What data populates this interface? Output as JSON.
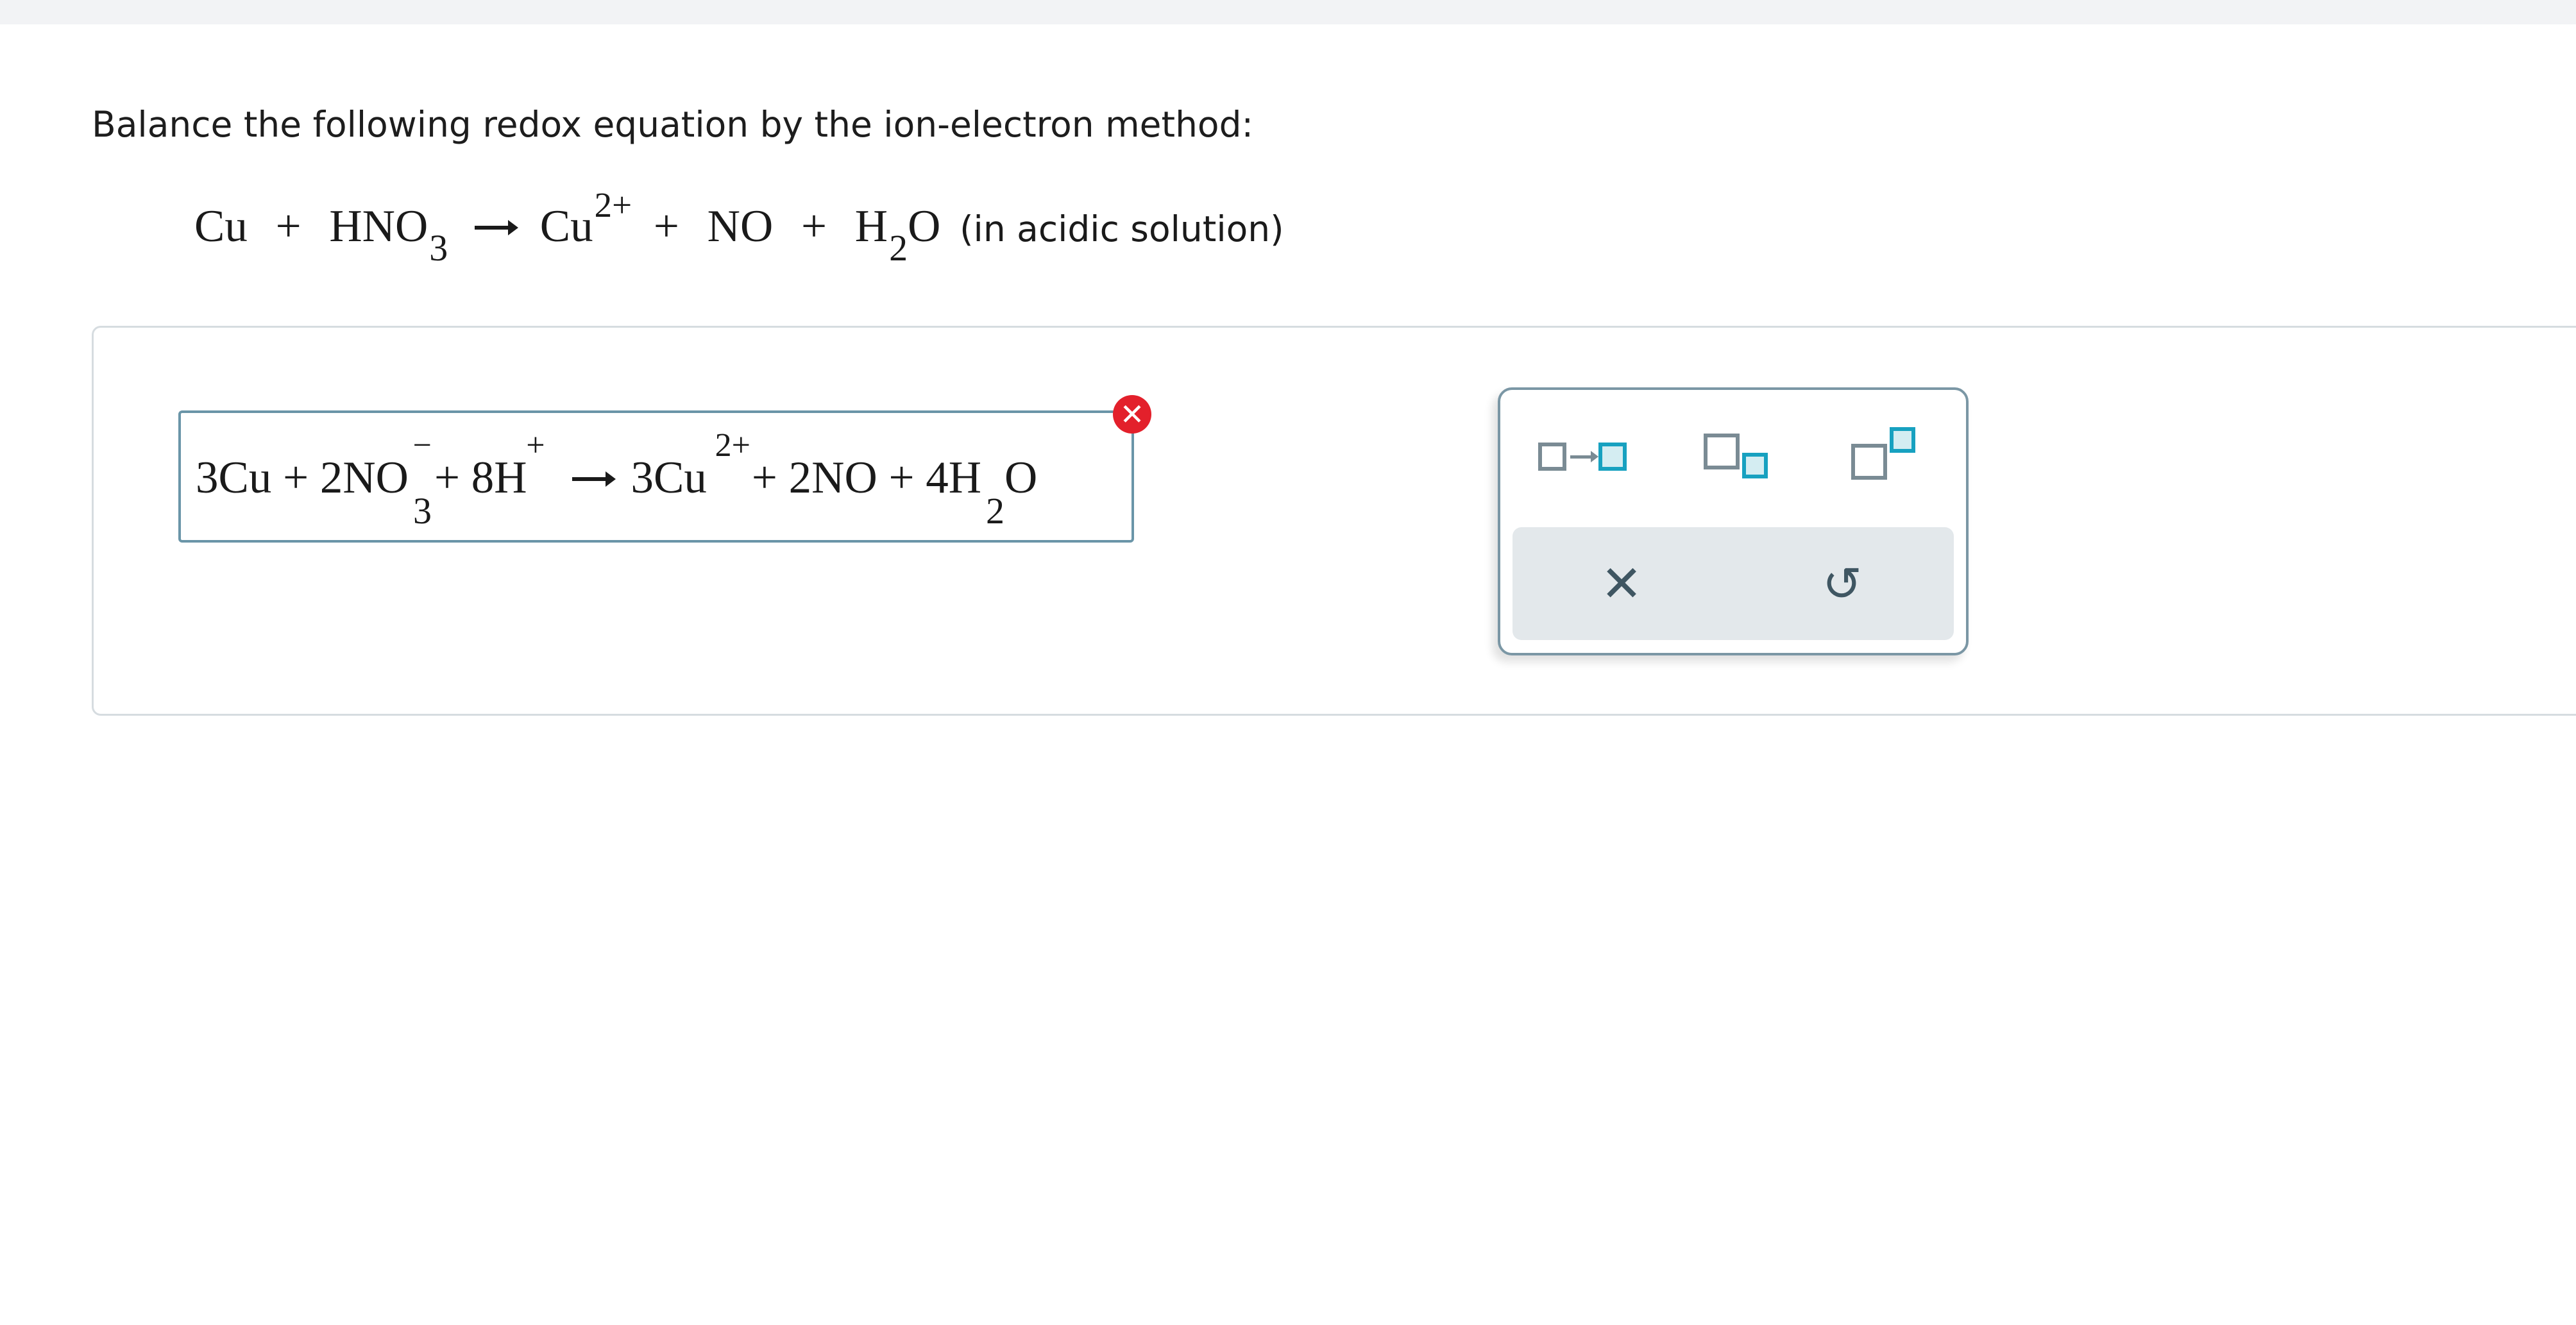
{
  "prompt": {
    "text": "Balance the following redox equation by the ion-electron method:"
  },
  "equation": {
    "reactant1": "Cu",
    "plus1": "+",
    "reactant2_base": "HNO",
    "reactant2_sub": "3",
    "product1_base": "Cu",
    "product1_sup": "2+",
    "plus2": "+",
    "product2": "NO",
    "plus3": "+",
    "product3_pre": "H",
    "product3_sub": "2",
    "product3_post": "O",
    "condition": "(in acidic solution)"
  },
  "answer": {
    "t1": "3Cu + 2NO",
    "t1_sub": "3",
    "t1_sup": "−",
    "t2": "+ 8H",
    "t2_sup": "+",
    "t3": "3Cu",
    "t3_sup": "2+",
    "t4": "+ 2NO + 4H",
    "t4_sub": "2",
    "t5": "O"
  },
  "error_badge": {
    "symbol": "✕"
  },
  "toolbox": {
    "clear_symbol": "✕",
    "undo_symbol": "↺"
  },
  "colors": {
    "accent": "#17a1c0",
    "border": "#7b97a5",
    "error": "#e3202b",
    "toolbar_bg": "#e3e8eb"
  },
  "icons": [
    "reaction-arrow-icon",
    "subscript-icon",
    "superscript-icon",
    "clear-icon",
    "undo-icon",
    "error-icon"
  ]
}
